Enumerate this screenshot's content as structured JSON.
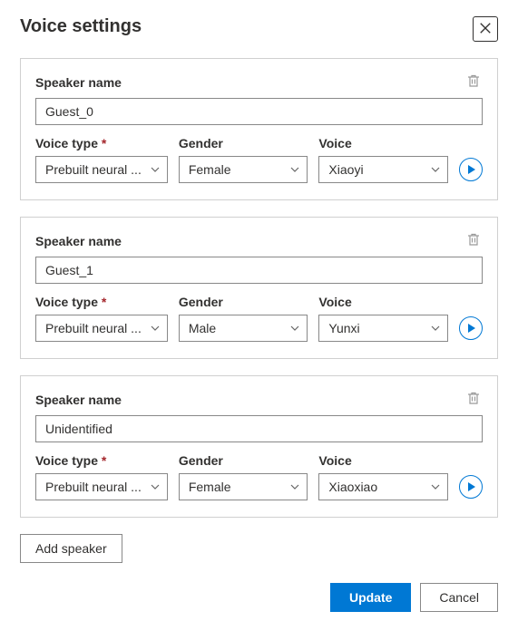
{
  "title": "Voice settings",
  "labels": {
    "speaker_name": "Speaker name",
    "voice_type": "Voice type",
    "gender": "Gender",
    "voice": "Voice"
  },
  "speakers": [
    {
      "name": "Guest_0",
      "voice_type": "Prebuilt neural ...",
      "gender": "Female",
      "voice": "Xiaoyi"
    },
    {
      "name": "Guest_1",
      "voice_type": "Prebuilt neural ...",
      "gender": "Male",
      "voice": "Yunxi"
    },
    {
      "name": "Unidentified",
      "voice_type": "Prebuilt neural ...",
      "gender": "Female",
      "voice": "Xiaoxiao"
    }
  ],
  "buttons": {
    "add_speaker": "Add speaker",
    "update": "Update",
    "cancel": "Cancel"
  }
}
